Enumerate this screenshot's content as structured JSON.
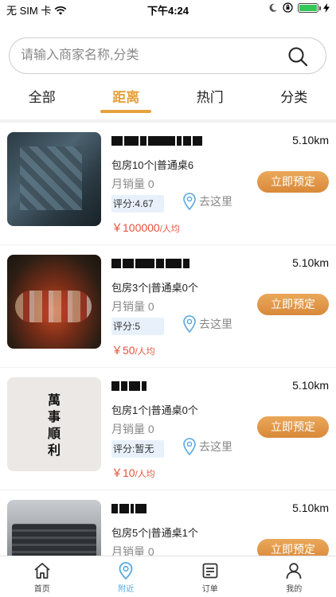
{
  "status_bar": {
    "carrier": "无 SIM 卡",
    "time": "下午4:24"
  },
  "search": {
    "placeholder": "请输入商家名称,分类"
  },
  "tabs": [
    {
      "label": "全部",
      "active": false
    },
    {
      "label": "距离",
      "active": true
    },
    {
      "label": "热门",
      "active": false
    },
    {
      "label": "分类",
      "active": false
    }
  ],
  "merchants": [
    {
      "distance": "5.10km",
      "rooms": "包房10个|普通桌6",
      "sales": "月销量 0",
      "rating": "评分:4.67",
      "goto": "去这里",
      "price": "￥100000",
      "price_unit": "/人均",
      "book": "立即预定",
      "calligraphy": ""
    },
    {
      "distance": "5.10km",
      "rooms": "包房3个|普通桌0个",
      "sales": "月销量 0",
      "rating": "评分:5",
      "goto": "去这里",
      "price": "￥50",
      "price_unit": "/人均",
      "book": "立即预定",
      "calligraphy": ""
    },
    {
      "distance": "5.10km",
      "rooms": "包房1个|普通桌0个",
      "sales": "月销量 0",
      "rating": "评分:暂无",
      "goto": "去这里",
      "price": "￥10",
      "price_unit": "/人均",
      "book": "立即预定",
      "calligraphy": "萬\n事\n順\n利"
    },
    {
      "distance": "5.10km",
      "rooms": "包房5个|普通桌1个",
      "sales": "月销量 0",
      "rating": "",
      "goto": "",
      "price": "",
      "price_unit": "",
      "book": "立即预定",
      "calligraphy": ""
    }
  ],
  "tabbar": [
    {
      "label": "首页",
      "icon": "home-icon",
      "active": false
    },
    {
      "label": "附近",
      "icon": "location-icon",
      "active": true
    },
    {
      "label": "订单",
      "icon": "order-icon",
      "active": false
    },
    {
      "label": "我的",
      "icon": "profile-icon",
      "active": false
    }
  ],
  "colors": {
    "accent": "#e6a23c",
    "price": "#e5533d",
    "tab_active": "#59a8e0",
    "button": "#d9893a"
  }
}
